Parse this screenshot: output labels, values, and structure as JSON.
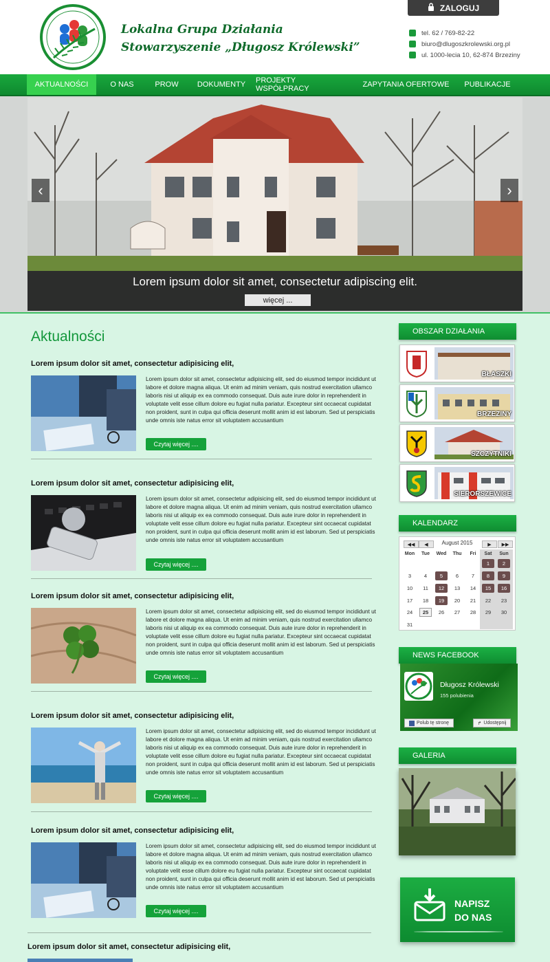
{
  "header": {
    "title_line1": "Lokalna Grupa Działania",
    "title_line2": "Stowarzyszenie „Długosz Królewski”",
    "logo_text": "LGD DŁUGOSZ KRÓLEWSKI",
    "login_label": "ZALOGUJ",
    "phone": "tel. 62 / 769-82-22",
    "email": "biuro@dlugoszkrolewski.org.pl",
    "address": "ul. 1000-lecia 10, 62-874 Brzeziny"
  },
  "nav": {
    "items": [
      "AKTUALNOŚCI",
      "O NAS",
      "PROW",
      "DOKUMENTY",
      "PROJEKTY WSPÓŁPRACY",
      "ZAPYTANIA OFERTOWE",
      "PUBLIKACJE"
    ],
    "active": "AKTUALNOŚCI"
  },
  "slider": {
    "caption": "Lorem ipsum dolor sit amet, consectetur adipiscing elit.",
    "more_label": "więcej ...",
    "prev": "‹",
    "next": "›"
  },
  "main": {
    "section_title": "Aktualności",
    "articles": [
      {
        "title": "Lorem ipsum dolor sit amet, consectetur adipisicing elit,",
        "text": "Lorem ipsum dolor sit amet, consectetur adipisicing elit, sed do eiusmod tempor incididunt ut labore et dolore magna aliqua. Ut enim ad minim veniam, quis nostrud exercitation ullamco laboris nisi ut aliquip ex ea commodo consequat. Duis aute irure dolor in reprehenderit in voluptate velit esse cillum dolore eu fugiat nulla pariatur. Excepteur sint occaecat cupidatat non proident, sunt in culpa qui officia deserunt mollit anim id est laborum. Sed ut perspiciatis unde omnis iste natus error sit voluptatem accusantium",
        "button": "Czytaj więcej ....",
        "image": "business-meeting"
      },
      {
        "title": "Lorem ipsum dolor sit amet, consectetur adipisicing elit,",
        "text": "Lorem ipsum dolor sit amet, consectetur adipisicing elit, sed do eiusmod tempor incididunt ut labore et dolore magna aliqua. Ut enim ad minim veniam, quis nostrud exercitation ullamco laboris nisi ut aliquip ex ea commodo consequat. Duis aute irure dolor in reprehenderit in voluptate velit esse cillum dolore eu fugiat nulla pariatur. Excepteur sint occaecat cupidatat non proident, sunt in culpa qui officia deserunt mollit anim id est laborum. Sed ut perspiciatis unde omnis iste natus error sit voluptatem accusantium",
        "button": "Czytaj więcej ....",
        "image": "laptop-globe"
      },
      {
        "title": "Lorem ipsum dolor sit amet, consectetur adipisicing elit,",
        "text": "Lorem ipsum dolor sit amet, consectetur adipisicing elit, sed do eiusmod tempor incididunt ut labore et dolore magna aliqua. Ut enim ad minim veniam, quis nostrud exercitation ullamco laboris nisi ut aliquip ex ea commodo consequat. Duis aute irure dolor in reprehenderit in voluptate velit esse cillum dolore eu fugiat nulla pariatur. Excepteur sint occaecat cupidatat non proident, sunt in culpa qui officia deserunt mollit anim id est laborum. Sed ut perspiciatis unde omnis iste natus error sit voluptatem accusantium",
        "button": "Czytaj więcej ....",
        "image": "clover"
      },
      {
        "title": "Lorem ipsum dolor sit amet, consectetur adipisicing elit,",
        "text": "Lorem ipsum dolor sit amet, consectetur adipisicing elit, sed do eiusmod tempor incididunt ut labore et dolore magna aliqua. Ut enim ad minim veniam, quis nostrud exercitation ullamco laboris nisi ut aliquip ex ea commodo consequat. Duis aute irure dolor in reprehenderit in voluptate velit esse cillum dolore eu fugiat nulla pariatur. Excepteur sint occaecat cupidatat non proident, sunt in culpa qui officia deserunt mollit anim id est laborum. Sed ut perspiciatis unde omnis iste natus error sit voluptatem accusantium",
        "button": "Czytaj więcej ....",
        "image": "beach-person"
      },
      {
        "title": "Lorem ipsum dolor sit amet, consectetur adipisicing elit,",
        "text": "Lorem ipsum dolor sit amet, consectetur adipisicing elit, sed do eiusmod tempor incididunt ut labore et dolore magna aliqua. Ut enim ad minim veniam, quis nostrud exercitation ullamco laboris nisi ut aliquip ex ea commodo consequat. Duis aute irure dolor in reprehenderit in voluptate velit esse cillum dolore eu fugiat nulla pariatur. Excepteur sint occaecat cupidatat non proident, sunt in culpa qui officia deserunt mollit anim id est laborum. Sed ut perspiciatis unde omnis iste natus error sit voluptatem accusantium",
        "button": "Czytaj więcej ....",
        "image": "business-meeting"
      }
    ],
    "last_article_title": "Lorem ipsum dolor sit amet, consectetur adipisicing elit,"
  },
  "sidebar": {
    "area_title": "OBSZAR DZIAŁANIA",
    "regions": [
      "BŁASZKI",
      "BRZEZINY",
      "SZCZYTNIKI",
      "SIERORSZEWICE"
    ],
    "calendar_title": "KALENDARZ",
    "calendar": {
      "month_label": "August 2015",
      "nav": [
        "◀◀",
        "◀",
        "▶",
        "▶▶"
      ],
      "dow": [
        "Mon",
        "Tue",
        "Wed",
        "Thu",
        "Fri",
        "Sat",
        "Sun"
      ],
      "today": 25,
      "event_days": [
        1,
        2,
        5,
        8,
        9,
        12,
        15,
        16,
        19
      ]
    },
    "facebook_title": "NEWS  FACEBOOK",
    "facebook": {
      "name": "Długosz Królewski",
      "likes": "155 polubienia",
      "like_btn": "Polub tę stronę",
      "share_btn": "Udostępnij"
    },
    "gallery_title": "GALERIA",
    "write_us": "NAPISZ DO NAS"
  },
  "colors": {
    "brand_green": "#13973b",
    "nav_active": "#37d14f",
    "content_bg": "#d8f5e4"
  }
}
